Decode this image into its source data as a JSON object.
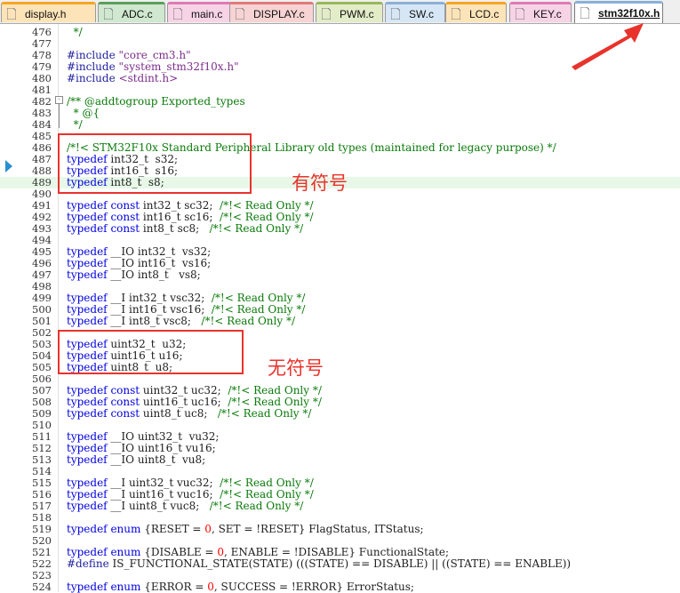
{
  "tabs": [
    {
      "label": "display.h",
      "color": "#f5a623",
      "bg": "#fde4b8"
    },
    {
      "label": "ADC.c",
      "color": "#5aa05a",
      "bg": "#cfe8cf"
    },
    {
      "label": "main.c",
      "color": "#e07ab5",
      "bg": "#f7d3e6"
    },
    {
      "label": "DISPLAY.c",
      "color": "#e07a7a",
      "bg": "#f7d3d3"
    },
    {
      "label": "PWM.c",
      "color": "#9ab85a",
      "bg": "#e2edc8"
    },
    {
      "label": "SW.c",
      "color": "#8ab0d8",
      "bg": "#d6e6f5"
    },
    {
      "label": "LCD.c",
      "color": "#f5a623",
      "bg": "#fde4b8"
    },
    {
      "label": "KEY.c",
      "color": "#e07ab5",
      "bg": "#f7d3e6"
    },
    {
      "label": "stm32f10x.h",
      "color": "#8ab0d8",
      "bg": "#ffffff"
    }
  ],
  "annotations": {
    "signed": "有符号",
    "unsigned": "无符号"
  },
  "colors": {
    "annotation": "#e8332c",
    "current_line": "#e8f8e8"
  },
  "lines": [
    {
      "n": "476",
      "t": [
        [
          "cm",
          "  */"
        ]
      ]
    },
    {
      "n": "477",
      "t": []
    },
    {
      "n": "478",
      "t": [
        [
          "pp",
          "#include "
        ],
        [
          "str",
          "\"core_cm3.h\""
        ]
      ]
    },
    {
      "n": "479",
      "t": [
        [
          "pp",
          "#include "
        ],
        [
          "str",
          "\"system_stm32f10x.h\""
        ]
      ]
    },
    {
      "n": "480",
      "t": [
        [
          "pp",
          "#include "
        ],
        [
          "str",
          "<stdint.h>"
        ]
      ]
    },
    {
      "n": "481",
      "t": []
    },
    {
      "n": "482",
      "t": [
        [
          "cm",
          "/** @addtogroup Exported_types"
        ]
      ]
    },
    {
      "n": "483",
      "t": [
        [
          "cm",
          "  * @{"
        ]
      ]
    },
    {
      "n": "484",
      "t": [
        [
          "cm",
          "  */"
        ]
      ]
    },
    {
      "n": "485",
      "t": []
    },
    {
      "n": "486",
      "t": [
        [
          "cm",
          "/*!< STM32F10x Standard Peripheral Library old types (maintained for legacy purpose) */"
        ]
      ]
    },
    {
      "n": "487",
      "t": [
        [
          "kw",
          "typedef"
        ],
        [
          "plain",
          " int32_t  s32;"
        ]
      ]
    },
    {
      "n": "488",
      "t": [
        [
          "kw",
          "typedef"
        ],
        [
          "plain",
          " int16_t  s16;"
        ]
      ]
    },
    {
      "n": "489",
      "t": [
        [
          "kw",
          "typedef"
        ],
        [
          "plain",
          " int8_t  s8;"
        ]
      ]
    },
    {
      "n": "490",
      "t": []
    },
    {
      "n": "491",
      "t": [
        [
          "kw",
          "typedef"
        ],
        [
          "plain",
          " "
        ],
        [
          "kw",
          "const"
        ],
        [
          "plain",
          " int32_t sc32;  "
        ],
        [
          "cm",
          "/*!< Read Only */"
        ]
      ]
    },
    {
      "n": "492",
      "t": [
        [
          "kw",
          "typedef"
        ],
        [
          "plain",
          " "
        ],
        [
          "kw",
          "const"
        ],
        [
          "plain",
          " int16_t sc16;  "
        ],
        [
          "cm",
          "/*!< Read Only */"
        ]
      ]
    },
    {
      "n": "493",
      "t": [
        [
          "kw",
          "typedef"
        ],
        [
          "plain",
          " "
        ],
        [
          "kw",
          "const"
        ],
        [
          "plain",
          " int8_t sc8;   "
        ],
        [
          "cm",
          "/*!< Read Only */"
        ]
      ]
    },
    {
      "n": "494",
      "t": []
    },
    {
      "n": "495",
      "t": [
        [
          "kw",
          "typedef"
        ],
        [
          "plain",
          " __IO int32_t  vs32;"
        ]
      ]
    },
    {
      "n": "496",
      "t": [
        [
          "kw",
          "typedef"
        ],
        [
          "plain",
          " __IO int16_t  vs16;"
        ]
      ]
    },
    {
      "n": "497",
      "t": [
        [
          "kw",
          "typedef"
        ],
        [
          "plain",
          " __IO int8_t   vs8;"
        ]
      ]
    },
    {
      "n": "498",
      "t": []
    },
    {
      "n": "499",
      "t": [
        [
          "kw",
          "typedef"
        ],
        [
          "plain",
          " __I int32_t vsc32;  "
        ],
        [
          "cm",
          "/*!< Read Only */"
        ]
      ]
    },
    {
      "n": "500",
      "t": [
        [
          "kw",
          "typedef"
        ],
        [
          "plain",
          " __I int16_t vsc16;  "
        ],
        [
          "cm",
          "/*!< Read Only */"
        ]
      ]
    },
    {
      "n": "501",
      "t": [
        [
          "kw",
          "typedef"
        ],
        [
          "plain",
          " __I int8_t vsc8;   "
        ],
        [
          "cm",
          "/*!< Read Only */"
        ]
      ]
    },
    {
      "n": "502",
      "t": []
    },
    {
      "n": "503",
      "t": [
        [
          "kw",
          "typedef"
        ],
        [
          "plain",
          " uint32_t  u32;"
        ]
      ]
    },
    {
      "n": "504",
      "t": [
        [
          "kw",
          "typedef"
        ],
        [
          "plain",
          " uint16_t u16;"
        ]
      ]
    },
    {
      "n": "505",
      "t": [
        [
          "kw",
          "typedef"
        ],
        [
          "plain",
          " uint8_t  u8;"
        ]
      ]
    },
    {
      "n": "506",
      "t": []
    },
    {
      "n": "507",
      "t": [
        [
          "kw",
          "typedef"
        ],
        [
          "plain",
          " "
        ],
        [
          "kw",
          "const"
        ],
        [
          "plain",
          " uint32_t uc32;  "
        ],
        [
          "cm",
          "/*!< Read Only */"
        ]
      ]
    },
    {
      "n": "508",
      "t": [
        [
          "kw",
          "typedef"
        ],
        [
          "plain",
          " "
        ],
        [
          "kw",
          "const"
        ],
        [
          "plain",
          " uint16_t uc16;  "
        ],
        [
          "cm",
          "/*!< Read Only */"
        ]
      ]
    },
    {
      "n": "509",
      "t": [
        [
          "kw",
          "typedef"
        ],
        [
          "plain",
          " "
        ],
        [
          "kw",
          "const"
        ],
        [
          "plain",
          " uint8_t uc8;   "
        ],
        [
          "cm",
          "/*!< Read Only */"
        ]
      ]
    },
    {
      "n": "510",
      "t": []
    },
    {
      "n": "511",
      "t": [
        [
          "kw",
          "typedef"
        ],
        [
          "plain",
          " __IO uint32_t  vu32;"
        ]
      ]
    },
    {
      "n": "512",
      "t": [
        [
          "kw",
          "typedef"
        ],
        [
          "plain",
          " __IO uint16_t vu16;"
        ]
      ]
    },
    {
      "n": "513",
      "t": [
        [
          "kw",
          "typedef"
        ],
        [
          "plain",
          " __IO uint8_t  vu8;"
        ]
      ]
    },
    {
      "n": "514",
      "t": []
    },
    {
      "n": "515",
      "t": [
        [
          "kw",
          "typedef"
        ],
        [
          "plain",
          " __I uint32_t vuc32;  "
        ],
        [
          "cm",
          "/*!< Read Only */"
        ]
      ]
    },
    {
      "n": "516",
      "t": [
        [
          "kw",
          "typedef"
        ],
        [
          "plain",
          " __I uint16_t vuc16;  "
        ],
        [
          "cm",
          "/*!< Read Only */"
        ]
      ]
    },
    {
      "n": "517",
      "t": [
        [
          "kw",
          "typedef"
        ],
        [
          "plain",
          " __I uint8_t vuc8;   "
        ],
        [
          "cm",
          "/*!< Read Only */"
        ]
      ]
    },
    {
      "n": "518",
      "t": []
    },
    {
      "n": "519",
      "t": [
        [
          "kw",
          "typedef"
        ],
        [
          "plain",
          " "
        ],
        [
          "kw",
          "enum"
        ],
        [
          "plain",
          " {RESET = "
        ],
        [
          "num",
          "0"
        ],
        [
          "plain",
          ", SET = !RESET} FlagStatus, ITStatus;"
        ]
      ]
    },
    {
      "n": "520",
      "t": []
    },
    {
      "n": "521",
      "t": [
        [
          "kw",
          "typedef"
        ],
        [
          "plain",
          " "
        ],
        [
          "kw",
          "enum"
        ],
        [
          "plain",
          " {DISABLE = "
        ],
        [
          "num",
          "0"
        ],
        [
          "plain",
          ", ENABLE = !DISABLE} FunctionalState;"
        ]
      ]
    },
    {
      "n": "522",
      "t": [
        [
          "pp",
          "#define"
        ],
        [
          "plain",
          " IS_FUNCTIONAL_STATE(STATE) (((STATE) == DISABLE) || ((STATE) == ENABLE))"
        ]
      ]
    },
    {
      "n": "523",
      "t": []
    },
    {
      "n": "524",
      "t": [
        [
          "kw",
          "typedef"
        ],
        [
          "plain",
          " "
        ],
        [
          "kw",
          "enum"
        ],
        [
          "plain",
          " {ERROR = "
        ],
        [
          "num",
          "0"
        ],
        [
          "plain",
          ", SUCCESS = !ERROR} ErrorStatus;"
        ]
      ]
    }
  ]
}
